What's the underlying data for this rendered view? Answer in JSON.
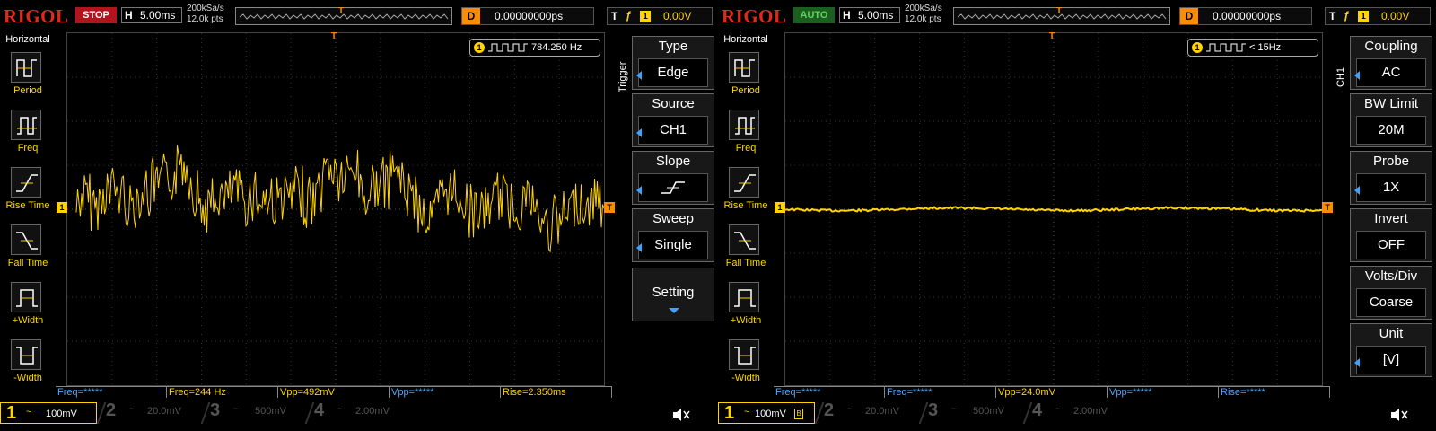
{
  "left_scope": {
    "brand": "RIGOL",
    "run_state": "STOP",
    "timebase_label": "H",
    "timebase_value": "5.00ms",
    "sample_rate": "200kSa/s",
    "memory_depth": "12.0k pts",
    "delay_label": "D",
    "delay_value": "0.00000000ps",
    "trigger_label": "T",
    "trigger_channel": "1",
    "trigger_level": "0.00V",
    "horizontal_menu": {
      "title": "Horizontal",
      "items": [
        "Period",
        "Freq",
        "Rise Time",
        "Fall Time",
        "+Width",
        "-Width"
      ]
    },
    "freq_counter": {
      "channel": "1",
      "value": "784.250 Hz"
    },
    "softkey_menu": {
      "title": "Trigger",
      "keys": [
        {
          "title": "Type",
          "value": "Edge"
        },
        {
          "title": "Source",
          "value": "CH1"
        },
        {
          "title": "Slope",
          "value": ""
        },
        {
          "title": "Sweep",
          "value": "Single"
        },
        {
          "title": "Setting",
          "value": ""
        }
      ]
    },
    "measurements": [
      "Freq=*****",
      "Freq=244 Hz",
      "Vpp=492mV",
      "Vpp=*****",
      "Rise=2.350ms"
    ],
    "channels": [
      {
        "num": "1",
        "coupling": "~",
        "scale": "100mV",
        "color": "#ffd400"
      },
      {
        "num": "2",
        "coupling": "~",
        "scale": "20.0mV",
        "color": "#3a8fd8"
      },
      {
        "num": "3",
        "coupling": "~",
        "scale": "500mV",
        "color": "#c23ac2"
      },
      {
        "num": "4",
        "coupling": "~",
        "scale": "2.00mV",
        "color": "#2b6fd1"
      }
    ]
  },
  "right_scope": {
    "brand": "RIGOL",
    "run_state": "AUTO",
    "timebase_label": "H",
    "timebase_value": "5.00ms",
    "sample_rate": "200kSa/s",
    "memory_depth": "12.0k pts",
    "delay_label": "D",
    "delay_value": "0.00000000ps",
    "trigger_label": "T",
    "trigger_channel": "1",
    "trigger_level": "0.00V",
    "horizontal_menu": {
      "title": "Horizontal",
      "items": [
        "Period",
        "Freq",
        "Rise Time",
        "Fall Time",
        "+Width",
        "-Width"
      ]
    },
    "freq_counter": {
      "channel": "1",
      "value": "< 15Hz"
    },
    "softkey_menu": {
      "title": "CH1",
      "keys": [
        {
          "title": "Coupling",
          "value": "AC"
        },
        {
          "title": "BW Limit",
          "value": "20M"
        },
        {
          "title": "Probe",
          "value": "1X"
        },
        {
          "title": "Invert",
          "value": "OFF"
        },
        {
          "title": "Volts/Div",
          "value": "Coarse"
        },
        {
          "title": "Unit",
          "value": "[V]"
        }
      ]
    },
    "measurements": [
      "Freq=*****",
      "Freq=*****",
      "Vpp=24.0mV",
      "Vpp=*****",
      "Rise=*****"
    ],
    "channels": [
      {
        "num": "1",
        "coupling": "~",
        "scale": "100mV",
        "color": "#ffd400"
      },
      {
        "num": "2",
        "coupling": "~",
        "scale": "20.0mV",
        "color": "#3a8fd8"
      },
      {
        "num": "3",
        "coupling": "~",
        "scale": "500mV",
        "color": "#c23ac2"
      },
      {
        "num": "4",
        "coupling": "~",
        "scale": "2.00mV",
        "color": "#2b6fd1"
      }
    ]
  },
  "colors": {
    "trace": "#ffd400",
    "brand": "#e02a1a",
    "trigger_marker": "#ff8c00",
    "measure_label": "#4aa8ff"
  },
  "icons": {
    "horizontal_menu": [
      "period-icon",
      "freq-icon",
      "rise-time-icon",
      "fall-time-icon",
      "pos-width-icon",
      "neg-width-icon"
    ],
    "speaker": "speaker-muted-icon"
  }
}
